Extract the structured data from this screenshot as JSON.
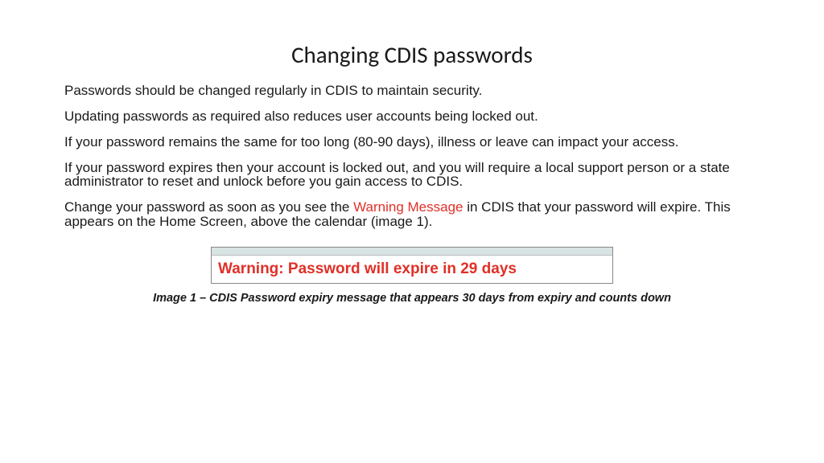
{
  "title": "Changing CDIS passwords",
  "paragraphs": {
    "p1": "Passwords should be changed regularly in CDIS to maintain security.",
    "p2": "Updating passwords as required also reduces user accounts being locked out.",
    "p3": "If your password remains the same for too long (80-90 days), illness or leave can impact your access.",
    "p4": "If your password expires then your account is locked out, and you will require a local support person or a state administrator to reset and unlock before you gain access to CDIS.",
    "p5_before": "Change your password as soon as you see the ",
    "p5_highlight": "Warning Message",
    "p5_after": " in CDIS that your password will expire. This appears on the Home Screen, above the calendar (image 1)."
  },
  "warning_box": {
    "text": "Warning: Password will expire in 29 days"
  },
  "caption": "Image 1 – CDIS Password expiry message that appears 30 days from expiry and counts down"
}
